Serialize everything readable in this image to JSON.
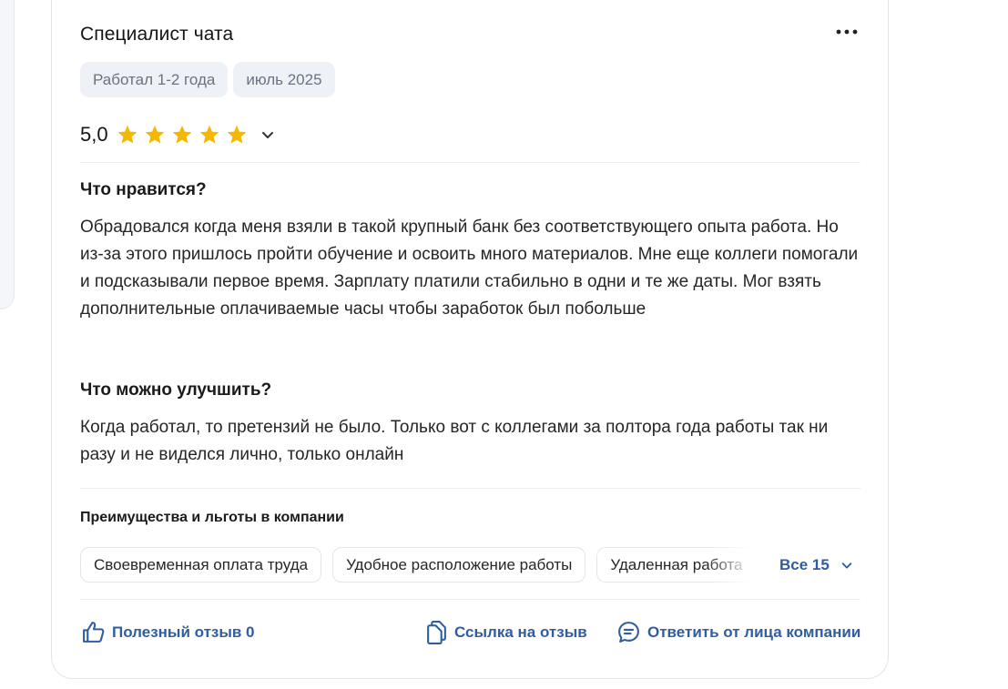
{
  "review": {
    "title": "Специалист чата",
    "tags": [
      "Работал 1-2 года",
      "июль 2025"
    ],
    "rating": "5,0",
    "stars": 5,
    "pros_title": "Что нравится?",
    "pros_text": "Обрадовался когда меня взяли в такой крупный банк без соответствующего опыта работа. Но из-за этого пришлось пройти обучение и освоить много материалов. Мне еще коллеги помогали и подсказывали первое время. Зарплату платили стабильно в одни и те же даты. Мог взять дополнительные оплачиваемые часы чтобы заработок был побольше",
    "cons_title": "Что можно улучшить?",
    "cons_text": "Когда работал, то претензий не было. Только вот с коллегами за полтора года работы так ни разу и не виделся лично, только онлайн",
    "benefits_title": "Преимущества и льготы в компании",
    "benefits": [
      "Своевременная оплата труда",
      "Удобное расположение работы",
      "Удаленная работа"
    ],
    "benefits_all": "Все 15",
    "actions": {
      "useful": "Полезный отзыв 0",
      "link": "Ссылка на отзыв",
      "reply": "Ответить от лица компании"
    }
  },
  "icons": {
    "more": "more-horizontal-icon",
    "star": "star-icon",
    "chevron": "chevron-down-icon",
    "like": "thumbs-up-icon",
    "copy": "copy-icon",
    "comment": "chat-bubble-icon"
  },
  "colors": {
    "accent": "#2f5da3",
    "star": "#f5b800",
    "tag_bg": "#eef1f6"
  }
}
